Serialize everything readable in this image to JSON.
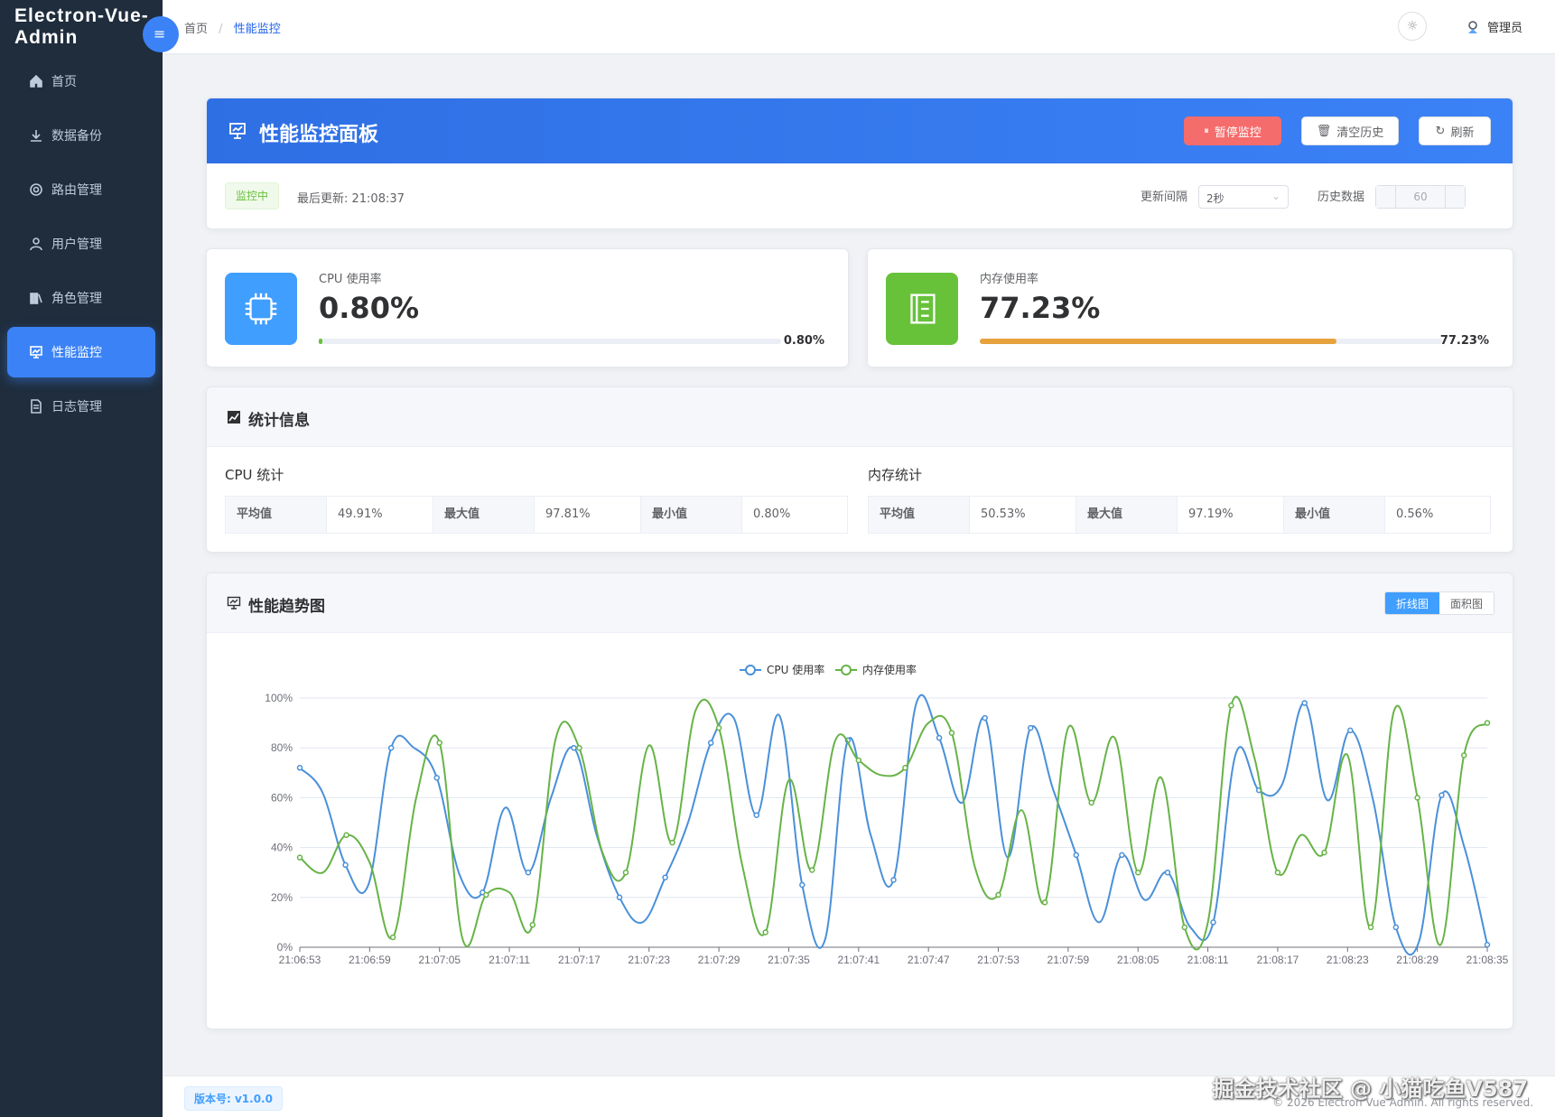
{
  "app": {
    "logo": "Electron-Vue-Admin"
  },
  "sidebar": {
    "collapse_icon": "menu-fold-icon",
    "items": [
      {
        "label": "首页",
        "icon": "home-icon"
      },
      {
        "label": "数据备份",
        "icon": "download-icon"
      },
      {
        "label": "路由管理",
        "icon": "gear-icon"
      },
      {
        "label": "用户管理",
        "icon": "user-icon"
      },
      {
        "label": "角色管理",
        "icon": "role-icon"
      },
      {
        "label": "性能监控",
        "icon": "monitor-icon",
        "active": true
      },
      {
        "label": "日志管理",
        "icon": "document-icon"
      }
    ]
  },
  "header": {
    "breadcrumb": [
      "首页",
      "性能监控"
    ],
    "breadcrumb_sep": "/",
    "user": "管理员",
    "theme_icon": "sun-icon"
  },
  "panel": {
    "title": "性能监控面板",
    "pause_label": "暂停监控",
    "clear_label": "清空历史",
    "refresh_label": "刷新",
    "status": "监控中",
    "last_update": "最后更新: 21:08:37",
    "interval_label": "更新间隔",
    "interval_value": "2秒",
    "history_label": "历史数据",
    "history_value": "60"
  },
  "metrics": {
    "cpu": {
      "label": "CPU 使用率",
      "value": "0.80%",
      "bar_text": "0.80%",
      "level": 0.008,
      "color": "#67c23a",
      "icon_bg": "#409eff"
    },
    "memory": {
      "label": "内存使用率",
      "value": "77.23%",
      "bar_text": "77.23%",
      "level": 0.7723,
      "color": "#e6a23c",
      "icon_bg": "#67c23a"
    }
  },
  "stats": {
    "title": "统计信息",
    "cpu": {
      "title": "CPU 统计",
      "avg_label": "平均值",
      "avg": "49.91%",
      "max_label": "最大值",
      "max": "97.81%",
      "min_label": "最小值",
      "min": "0.80%"
    },
    "memory": {
      "title": "内存统计",
      "avg_label": "平均值",
      "avg": "50.53%",
      "max_label": "最大值",
      "max": "97.19%",
      "min_label": "最小值",
      "min": "0.56%"
    }
  },
  "trend": {
    "title": "性能趋势图",
    "line_label": "折线图",
    "area_label": "面积图"
  },
  "footer": {
    "version": "版本号: v1.0.0",
    "copyright": "© 2026 Electron Vue Admin. All rights reserved.",
    "watermark": "掘金技术社区 @ 小猫吃鱼V587"
  },
  "chart_data": {
    "type": "line",
    "legend_position": "top-center",
    "ylim": [
      0,
      100
    ],
    "y_ticks": [
      "0%",
      "20%",
      "40%",
      "60%",
      "80%",
      "100%"
    ],
    "x_ticks": [
      "21:06:53",
      "21:06:59",
      "21:07:05",
      "21:07:11",
      "21:07:17",
      "21:07:23",
      "21:07:29",
      "21:07:35",
      "21:07:41",
      "21:07:47",
      "21:07:53",
      "21:07:59",
      "21:08:05",
      "21:08:11",
      "21:08:17",
      "21:08:23",
      "21:08:29",
      "21:08:35"
    ],
    "series": [
      {
        "name": "CPU 使用率",
        "color": "#4a90d9",
        "values": [
          72,
          62,
          33,
          25,
          80,
          80,
          68,
          29,
          22,
          56,
          30,
          60,
          80,
          45,
          20,
          10,
          28,
          50,
          82,
          92,
          53,
          93,
          25,
          3,
          83,
          45,
          27,
          98,
          84,
          58,
          92,
          36,
          88,
          63,
          37,
          10,
          37,
          19,
          30,
          8,
          10,
          78,
          63,
          65,
          98,
          59,
          87,
          59,
          8,
          2,
          61,
          40,
          1
        ]
      },
      {
        "name": "内存使用率",
        "color": "#67b347",
        "values": [
          36,
          30,
          45,
          34,
          4,
          60,
          82,
          3,
          21,
          22,
          9,
          84,
          80,
          38,
          30,
          81,
          42,
          95,
          88,
          33,
          6,
          67,
          31,
          83,
          75,
          69,
          72,
          90,
          86,
          32,
          21,
          55,
          18,
          88,
          58,
          84,
          30,
          68,
          8,
          10,
          97,
          76,
          30,
          45,
          38,
          77,
          8,
          95,
          60,
          1,
          77,
          90
        ]
      }
    ]
  }
}
